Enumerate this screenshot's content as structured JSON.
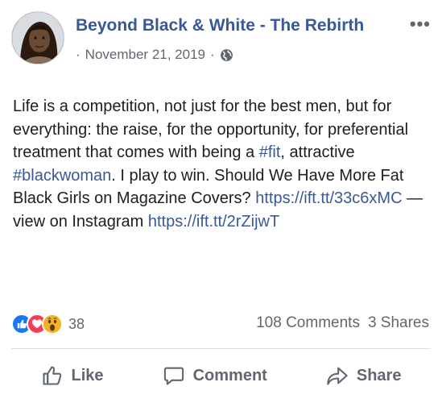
{
  "header": {
    "page_name": "Beyond Black & White - The Rebirth",
    "date_prefix": "·",
    "date": "November 21, 2019",
    "date_suffix": "·",
    "more_label": "•••"
  },
  "post": {
    "segments": [
      {
        "text": "Life is a competition, not just for the best men, but for everything: the raise, for the opportunity, for preferential treatment that comes with being a ",
        "link": false
      },
      {
        "text": "#fit",
        "link": true
      },
      {
        "text": ", attractive ",
        "link": false
      },
      {
        "text": "#blackwoman",
        "link": true
      },
      {
        "text": ". I play to win. Should We Have More Fat Black Girls on Magazine Covers? ",
        "link": false
      },
      {
        "text": "https://ift.tt/33c6xMC",
        "link": true
      },
      {
        "text": " — view on Instagram ",
        "link": false
      },
      {
        "text": "https://ift.tt/2rZijwT",
        "link": true
      }
    ]
  },
  "reactions": {
    "types": [
      "like",
      "love",
      "wow"
    ],
    "count": "38"
  },
  "stats": {
    "comments": "108 Comments",
    "shares": "3 Shares"
  },
  "actions": {
    "like": "Like",
    "comment": "Comment",
    "share": "Share"
  },
  "colors": {
    "link": "#385898",
    "muted": "#606770",
    "like": "#1877f2",
    "love": "#f33e58",
    "wow": "#f7b125"
  }
}
